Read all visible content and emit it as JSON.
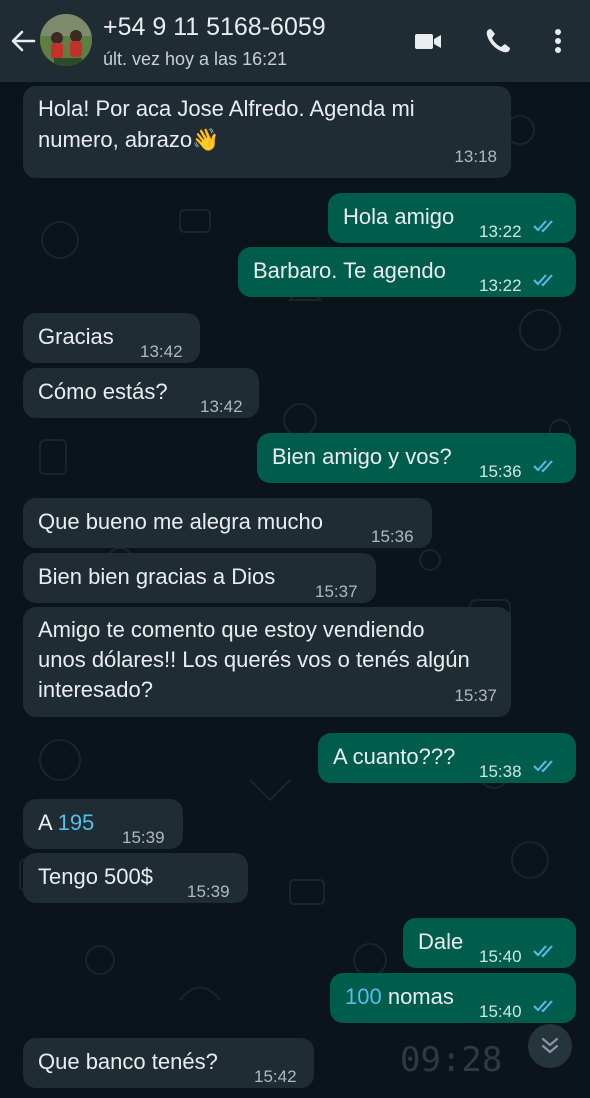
{
  "header": {
    "contact_name": "+54 9 11 5168-6059",
    "status": "últ. vez hoy a las 16:21",
    "icons": [
      "back-arrow-icon",
      "video-call-icon",
      "phone-icon",
      "more-options-icon"
    ]
  },
  "colors": {
    "header_bg": "#1f2c33",
    "chat_bg": "#0b141a",
    "incoming_bubble": "#202c33",
    "outgoing_bubble": "#005c4b",
    "read_ticks": "#53bdeb"
  },
  "messages": [
    {
      "dir": "in",
      "text": "Hola! Por aca Jose Alfredo. Agenda mi numero, abrazo👋",
      "time": "13:18"
    },
    {
      "dir": "out",
      "text": "Hola amigo",
      "time": "13:22"
    },
    {
      "dir": "out",
      "text": "Barbaro. Te agendo",
      "time": "13:22"
    },
    {
      "dir": "in",
      "text": "Gracias",
      "time": "13:42"
    },
    {
      "dir": "in",
      "text": "Cómo estás?",
      "time": "13:42"
    },
    {
      "dir": "out",
      "text": "Bien amigo y vos?",
      "time": "15:36"
    },
    {
      "dir": "in",
      "text": "Que bueno me alegra mucho",
      "time": "15:36"
    },
    {
      "dir": "in",
      "text": "Bien bien gracias a Dios",
      "time": "15:37"
    },
    {
      "dir": "in",
      "text": "Amigo te comento que estoy vendiendo unos dólares!! Los querés vos o tenés algún interesado?",
      "time": "15:37"
    },
    {
      "dir": "out",
      "text": "A cuanto???",
      "time": "15:38"
    },
    {
      "dir": "in",
      "text_prefix": "A ",
      "text_link": "195",
      "time": "15:39"
    },
    {
      "dir": "in",
      "text": "Tengo 500$",
      "time": "15:39"
    },
    {
      "dir": "out",
      "text": "Dale",
      "time": "15:40"
    },
    {
      "dir": "out",
      "text_link": "100",
      "text_suffix": " nomas",
      "time": "15:40"
    },
    {
      "dir": "in",
      "text": "Que banco tenés?",
      "time": "15:42"
    }
  ],
  "scroll_button_icon": "chevrons-down-icon",
  "wallpaper_badge": "09:28"
}
